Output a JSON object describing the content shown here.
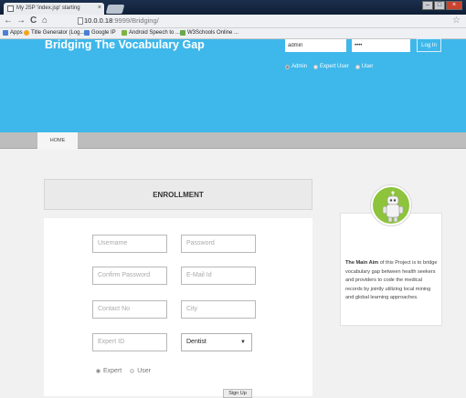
{
  "browser": {
    "tab_title": "My JSP 'index.jsp' starting",
    "tab_close": "×",
    "url_host": "10.0.0.18",
    "url_path": ":9999/Bridging/",
    "bookmarks": [
      {
        "label": "Apps",
        "color": "#4a7fd4"
      },
      {
        "label": "Title Generator (Log...",
        "color": "#f2a51c"
      },
      {
        "label": "Google IP",
        "color": "#4a7fd4"
      },
      {
        "label": "Android Speech to ...",
        "color": "#7cb342"
      },
      {
        "label": "W3Schools Online ...",
        "color": "#6aa84f"
      }
    ]
  },
  "header": {
    "title": "Bridging The Vocabulary Gap",
    "username_value": "admin",
    "password_value": "••••",
    "login_label": "Log In",
    "roles": [
      {
        "label": "Admin",
        "selected": true
      },
      {
        "label": "Expert User",
        "selected": false
      },
      {
        "label": "User",
        "selected": false
      }
    ]
  },
  "nav": {
    "home_label": "HOME"
  },
  "enrollment": {
    "title": "ENROLLMENT",
    "fields": {
      "username": "Username",
      "password": "Password",
      "confirm_password": "Confirm Password",
      "email": "E-Mail Id",
      "contact": "Contact No",
      "city": "City",
      "expert_id": "Expert ID"
    },
    "specialty_selected": "Dentist",
    "role_options": [
      {
        "label": "Expert",
        "selected": true
      },
      {
        "label": "User",
        "selected": false
      }
    ],
    "signup_label": "Sign Up"
  },
  "info": {
    "lead": "The Main Aim",
    "text": " of this Project is to bridge vocabulary gap between health seekers and providers to code the medical records by jointly utilizing local mining and global learning approaches."
  },
  "colors": {
    "brand": "#3eb7ea",
    "menubar": "#bdbdbd",
    "avatar": "#8dc43b"
  }
}
